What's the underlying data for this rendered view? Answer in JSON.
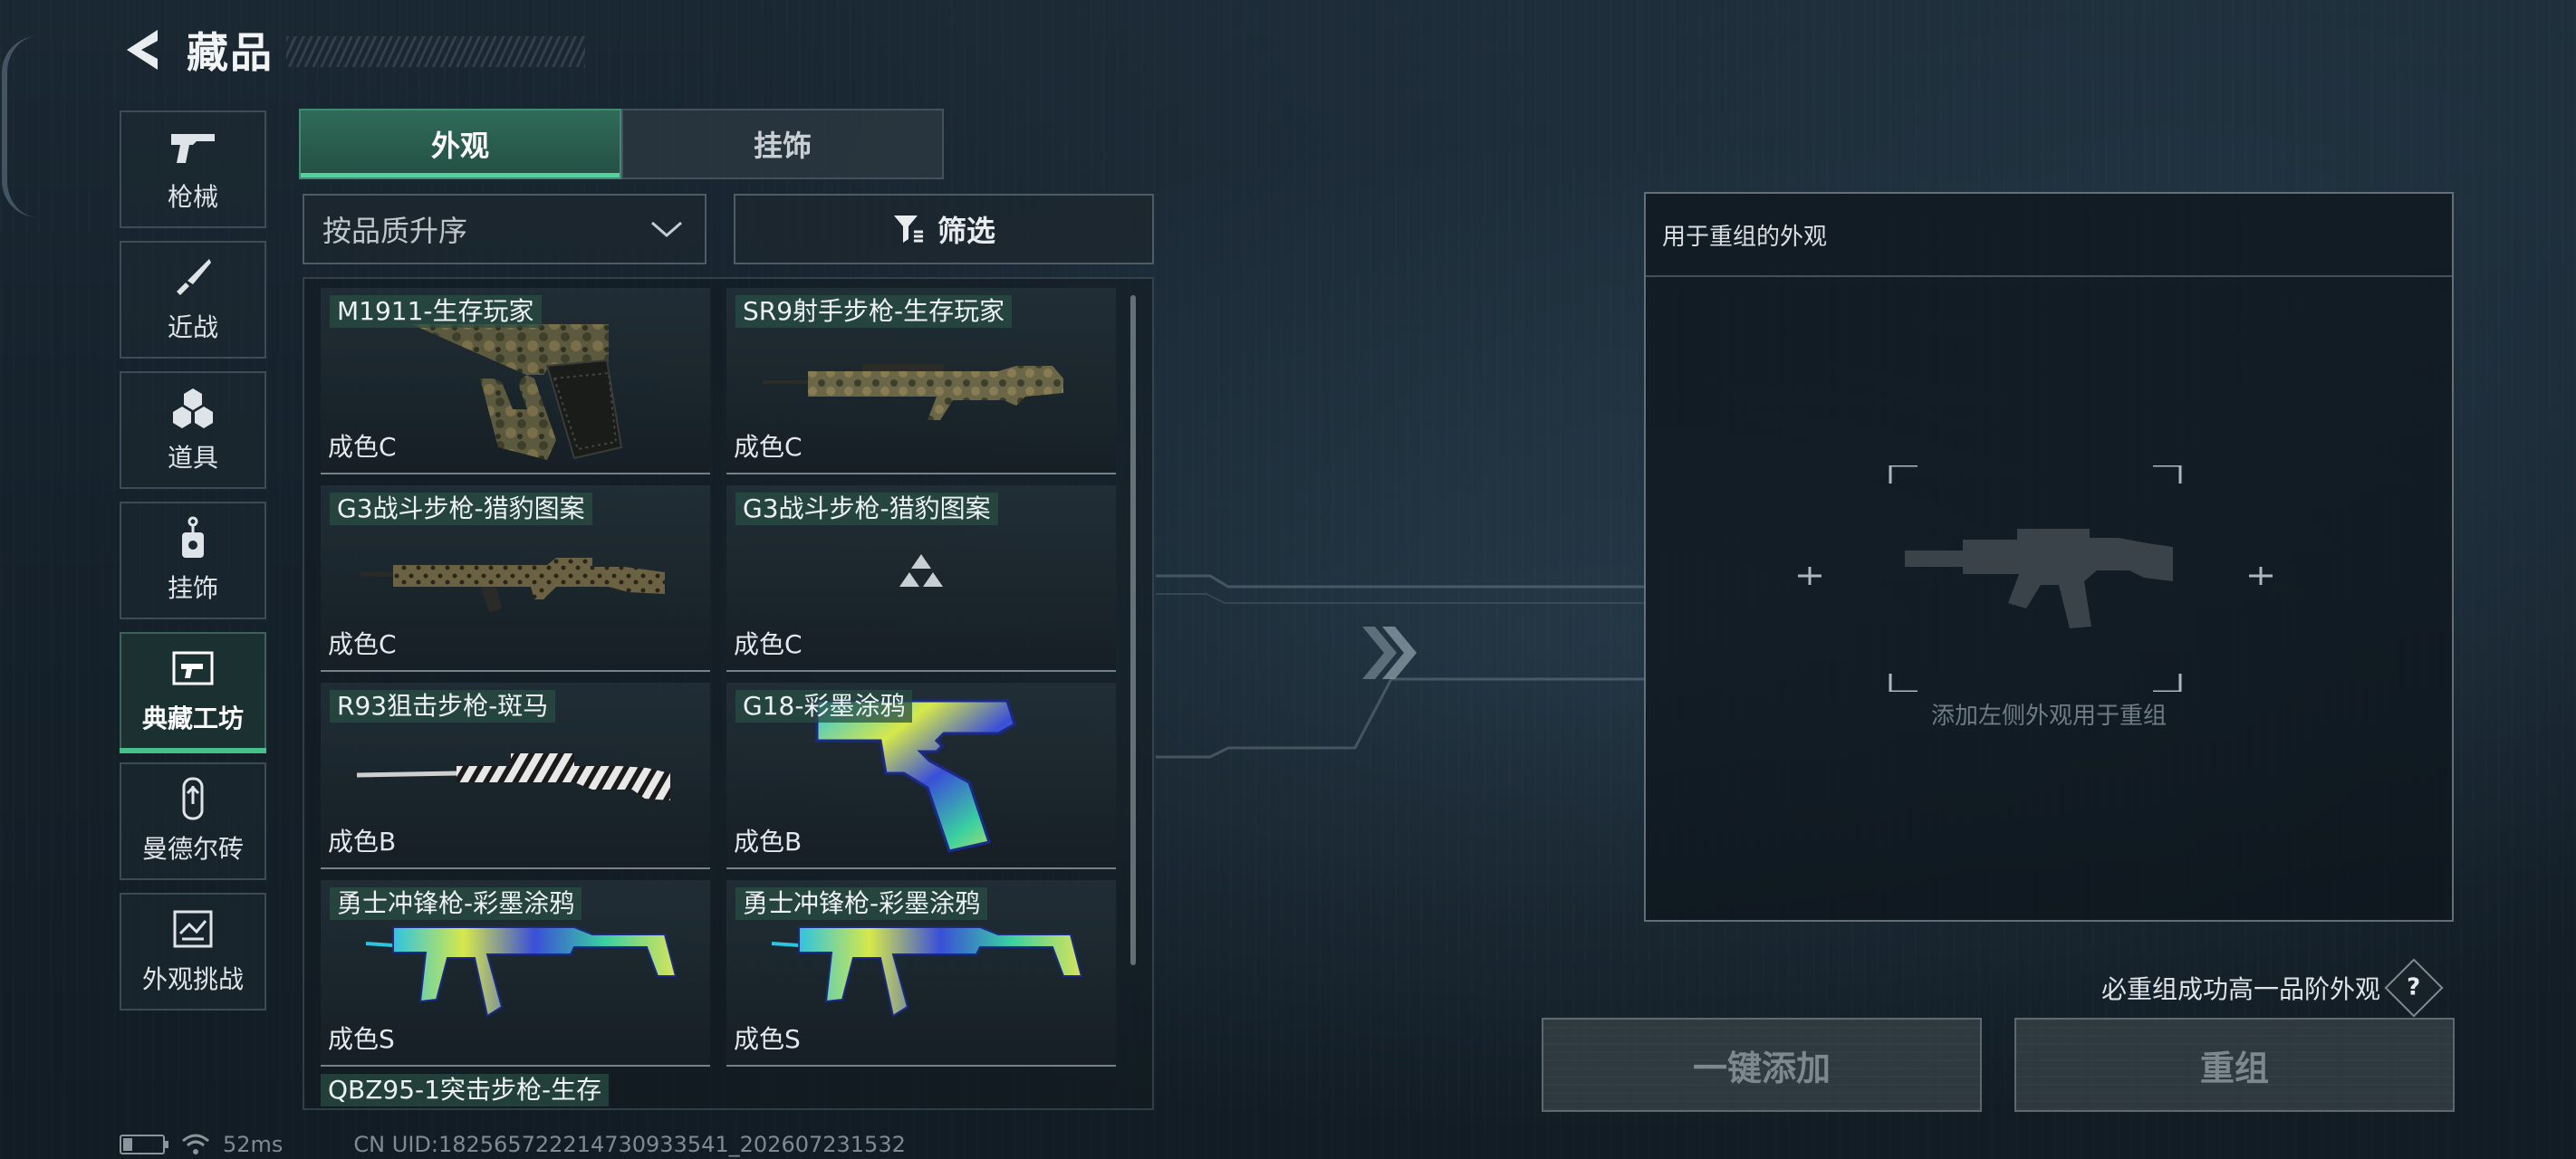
{
  "header": {
    "title": "藏品"
  },
  "sidebar": {
    "items": [
      {
        "label": "枪械",
        "icon": "pistol-icon"
      },
      {
        "label": "近战",
        "icon": "knife-icon"
      },
      {
        "label": "道具",
        "icon": "grenade-icon"
      },
      {
        "label": "挂饰",
        "icon": "charm-icon"
      },
      {
        "label": "典藏工坊",
        "icon": "workshop-icon",
        "active": true
      },
      {
        "label": "曼德尔砖",
        "icon": "brick-icon"
      },
      {
        "label": "外观挑战",
        "icon": "challenge-icon"
      }
    ]
  },
  "tabs": [
    {
      "label": "外观",
      "active": true
    },
    {
      "label": "挂饰",
      "active": false
    }
  ],
  "controls": {
    "sort_label": "按品质升序",
    "filter_label": "筛选"
  },
  "skins": [
    {
      "name": "M1911-生存玩家",
      "grade": "成色C",
      "weapon": "pistol-camo"
    },
    {
      "name": "SR9射手步枪-生存玩家",
      "grade": "成色C",
      "weapon": "rifle-camo"
    },
    {
      "name": "G3战斗步枪-猎豹图案",
      "grade": "成色C",
      "weapon": "g3-leopard"
    },
    {
      "name": "G3战斗步枪-猎豹图案",
      "grade": "成色C",
      "weapon": "loading-placeholder"
    },
    {
      "name": "R93狙击步枪-斑马",
      "grade": "成色B",
      "weapon": "sniper-zebra"
    },
    {
      "name": "G18-彩墨涂鸦",
      "grade": "成色B",
      "weapon": "pistol-graffiti"
    },
    {
      "name": "勇士冲锋枪-彩墨涂鸦",
      "grade": "成色S",
      "weapon": "smg-graffiti"
    },
    {
      "name": "勇士冲锋枪-彩墨涂鸦",
      "grade": "成色S",
      "weapon": "smg-graffiti"
    }
  ],
  "partial_item": "QBZ95-1突击步枪-生存",
  "panel": {
    "title": "用于重组的外观",
    "hint": "添加左侧外观用于重组"
  },
  "guarantee_text": "必重组成功高一品阶外观",
  "help_label": "?",
  "buttons": {
    "add_all": "一键添加",
    "recombine": "重组"
  },
  "status": {
    "ping": "52ms",
    "uid": "CN UID:18256572221473093354​1_202607231532"
  },
  "colors": {
    "accent": "#45c28a",
    "tab_active": "#2f6b58",
    "name_tag": "#284e42"
  }
}
